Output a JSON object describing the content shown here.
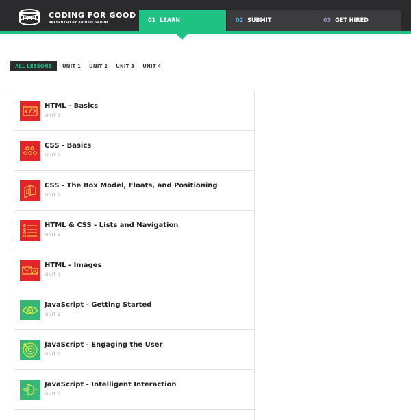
{
  "header": {
    "brand_title": "CODING FOR GOOD",
    "brand_subtitle": "PRESENTED BY APOLLO GROUP",
    "tabs": [
      {
        "num": "01",
        "label": "LEARN",
        "active": true
      },
      {
        "num": "02",
        "label": "SUBMIT",
        "active": false
      },
      {
        "num": "03",
        "label": "GET HIRED",
        "active": false
      }
    ]
  },
  "filters": [
    "ALL LESSONS",
    "UNIT 1",
    "UNIT 2",
    "UNIT 3",
    "UNIT 4"
  ],
  "active_filter": "ALL LESSONS",
  "lessons": [
    {
      "title": "HTML - Basics",
      "unit": "UNIT 1",
      "icon": "code-icon",
      "color": "#e1252b"
    },
    {
      "title": "CSS - Basics",
      "unit": "UNIT 1",
      "icon": "circles-icon",
      "color": "#e1252b"
    },
    {
      "title": "CSS - The Box Model, Floats, and Positioning",
      "unit": "UNIT 1",
      "icon": "box-model-icon",
      "color": "#e1252b"
    },
    {
      "title": "HTML & CSS - Lists and Navigation",
      "unit": "UNIT 1",
      "icon": "list-icon",
      "color": "#e1252b"
    },
    {
      "title": "HTML - Images",
      "unit": "UNIT 1",
      "icon": "image-icon",
      "color": "#e1252b"
    },
    {
      "title": "JavaScript - Getting Started",
      "unit": "UNIT 2",
      "icon": "eye-icon",
      "color": "#38b678"
    },
    {
      "title": "JavaScript - Engaging the User",
      "unit": "UNIT 2",
      "icon": "target-icon",
      "color": "#38b678"
    },
    {
      "title": "JavaScript - Intelligent Interaction",
      "unit": "UNIT 2",
      "icon": "interaction-icon",
      "color": "#38b678"
    }
  ],
  "colors": {
    "accent_green": "#1fc283",
    "header_bg": "#2b2b2d",
    "lesson_red": "#e1252b",
    "lesson_green": "#38b678"
  }
}
